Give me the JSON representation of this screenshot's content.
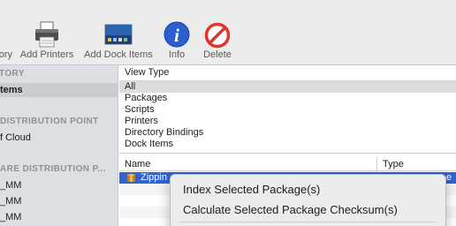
{
  "toolbar": {
    "items": [
      {
        "label": "ory",
        "icon": "history-icon"
      },
      {
        "label": "Add Printers",
        "icon": "printer-icon"
      },
      {
        "label": "Add Dock Items",
        "icon": "dock-items-icon"
      },
      {
        "label": "Info",
        "icon": "info-icon"
      },
      {
        "label": "Delete",
        "icon": "delete-icon"
      }
    ]
  },
  "sidebar": {
    "section1_heading": "TORY",
    "section1_item": "tems",
    "section2_heading": "DISTRIBUTION POINT",
    "section2_item": "f Cloud",
    "section3_heading": "ARE DISTRIBUTION P...",
    "section3_items": [
      "_MM",
      "_MM",
      "_MM"
    ]
  },
  "view_type": {
    "title": "View Type",
    "options": [
      "All",
      "Packages",
      "Scripts",
      "Printers",
      "Directory Bindings",
      "Dock Items"
    ],
    "selected": "All"
  },
  "table": {
    "columns": [
      "Name",
      "Type"
    ],
    "rows": [
      {
        "name": "Zippin",
        "type": "e"
      }
    ]
  },
  "context_menu": {
    "items": [
      "Index Selected Package(s)",
      "Calculate Selected Package Checksum(s)"
    ]
  },
  "colors": {
    "selection_blue": "#2f63d6",
    "sidebar_bg": "#dcdfe4",
    "toolbar_bg": "#ececec",
    "info_blue": "#2b5fd0",
    "delete_red": "#e0352b"
  }
}
